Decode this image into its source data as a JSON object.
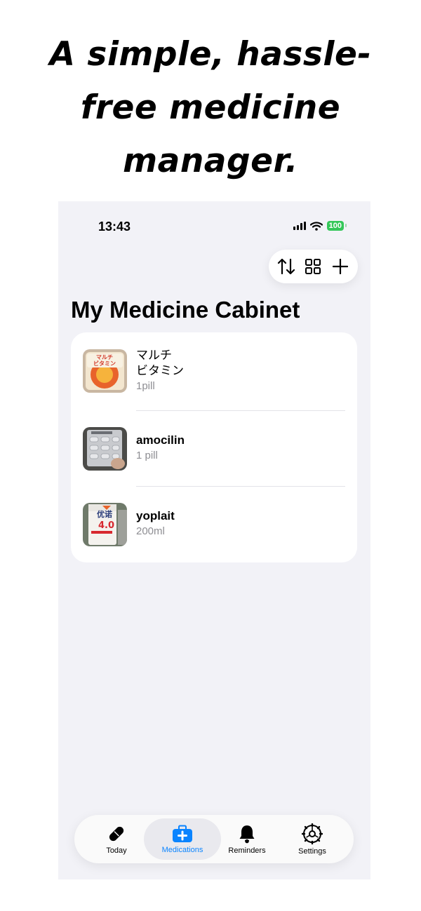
{
  "headline": {
    "line1": "A simple, hassle-",
    "line2": "free medicine",
    "line3": "manager."
  },
  "status_bar": {
    "time": "13:43",
    "battery": "100"
  },
  "toolbar": {
    "icons": [
      "sort-icon",
      "grid-icon",
      "plus-icon"
    ]
  },
  "page_title": "My Medicine Cabinet",
  "medications": [
    {
      "name_line1": "マルチ",
      "name_line2": "ビタミン",
      "dose": "1pill",
      "thumb_label": "マルチ ビタミン"
    },
    {
      "name_line1": "amocilin",
      "dose": "1 pill"
    },
    {
      "name_line1": "yoplait",
      "dose": "200ml",
      "thumb_label": "优诺 4.0"
    }
  ],
  "tabbar": {
    "items": [
      {
        "label": "Today",
        "icon": "pill-icon"
      },
      {
        "label": "Medications",
        "icon": "medkit-icon",
        "active": true
      },
      {
        "label": "Reminders",
        "icon": "bell-icon"
      },
      {
        "label": "Settings",
        "icon": "gear-icon"
      }
    ],
    "active_color": "#0a84ff"
  },
  "colors": {
    "background": "#f2f2f7",
    "battery": "#34c759",
    "accent": "#0a84ff"
  }
}
